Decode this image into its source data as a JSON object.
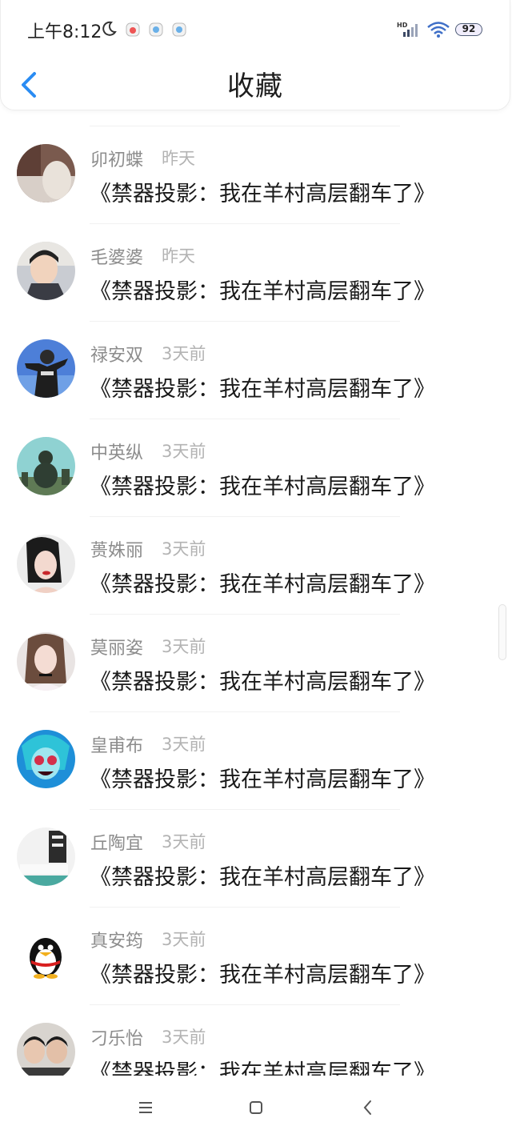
{
  "status_bar": {
    "time": "上午8:12",
    "battery": "92",
    "signal_label": "HD"
  },
  "header": {
    "title": "收藏",
    "back_icon": "chevron-left-icon"
  },
  "colors": {
    "accent": "#2a8cf3",
    "text_primary": "#1a1a1a",
    "text_secondary": "#8c8c8c",
    "text_tertiary": "#b3b3b3"
  },
  "favorites": [
    {
      "name": "卯初蝶",
      "time": "昨天",
      "title": "《禁器投影：我在羊村高层翻车了》"
    },
    {
      "name": "毛婆婆",
      "time": "昨天",
      "title": "《禁器投影：我在羊村高层翻车了》"
    },
    {
      "name": "禄安双",
      "time": "3天前",
      "title": "《禁器投影：我在羊村高层翻车了》"
    },
    {
      "name": "中英纵",
      "time": "3天前",
      "title": "《禁器投影：我在羊村高层翻车了》"
    },
    {
      "name": "蒉姝丽",
      "time": "3天前",
      "title": "《禁器投影：我在羊村高层翻车了》"
    },
    {
      "name": "莫丽姿",
      "time": "3天前",
      "title": "《禁器投影：我在羊村高层翻车了》"
    },
    {
      "name": "皇甫布",
      "time": "3天前",
      "title": "《禁器投影：我在羊村高层翻车了》"
    },
    {
      "name": "丘陶宜",
      "time": "3天前",
      "title": "《禁器投影：我在羊村高层翻车了》"
    },
    {
      "name": "真安筠",
      "time": "3天前",
      "title": "《禁器投影：我在羊村高层翻车了》"
    },
    {
      "name": "刁乐怡",
      "time": "3天前",
      "title": "《禁器投影：我在羊村高层翻车了》"
    }
  ],
  "nav_bar": {
    "icons": [
      "menu-icon",
      "home-square-icon",
      "back-triangle-icon"
    ]
  }
}
